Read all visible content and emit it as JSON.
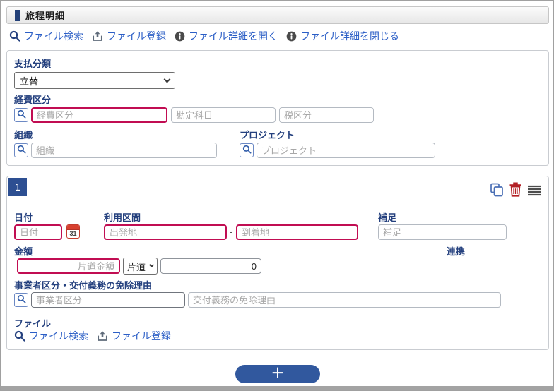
{
  "colors": {
    "accent_navy": "#234078",
    "label_navy": "#24407e",
    "link_blue": "#2b5ec6",
    "required_red": "#c10d52",
    "badge_navy": "#2d4f92",
    "button_navy": "#31589e",
    "trash_red": "#b32025",
    "copy_blue": "#4a6fb5"
  },
  "header": {
    "title": "旅程明細"
  },
  "toolbar": {
    "links": [
      {
        "icon": "search-icon",
        "label": "ファイル検索"
      },
      {
        "icon": "upload-icon",
        "label": "ファイル登録"
      },
      {
        "icon": "info-icon",
        "label": "ファイル詳細を開く"
      },
      {
        "icon": "info-icon",
        "label": "ファイル詳細を閉じる"
      }
    ]
  },
  "summary_form": {
    "payment_class_label": "支払分類",
    "payment_class_value": "立替",
    "expense_category_label": "経費区分",
    "expense_category_placeholder": "経費区分",
    "account_title_placeholder": "勘定科目",
    "tax_class_placeholder": "税区分",
    "organization_label": "組織",
    "organization_placeholder": "組織",
    "project_label": "プロジェクト",
    "project_placeholder": "プロジェクト"
  },
  "item": {
    "number": "1",
    "date_label": "日付",
    "date_placeholder": "日付",
    "calendar_day": "31",
    "route_label": "利用区間",
    "departure_placeholder": "出発地",
    "route_separator": "-",
    "arrival_placeholder": "到着地",
    "note_label": "補足",
    "note_placeholder": "補足",
    "amount_label": "金額",
    "oneway_amount_placeholder": "片道金額",
    "trip_type_value": "片道",
    "amount_total": "0",
    "link_label": "連携",
    "business_label": "事業者区分・交付義務の免除理由",
    "business_category_placeholder": "事業者区分",
    "exemption_reason_placeholder": "交付義務の免除理由",
    "file_label": "ファイル",
    "file_links": [
      {
        "icon": "search-icon",
        "label": "ファイル検索"
      },
      {
        "icon": "upload-icon",
        "label": "ファイル登録"
      }
    ]
  },
  "add_button_label": "＋"
}
